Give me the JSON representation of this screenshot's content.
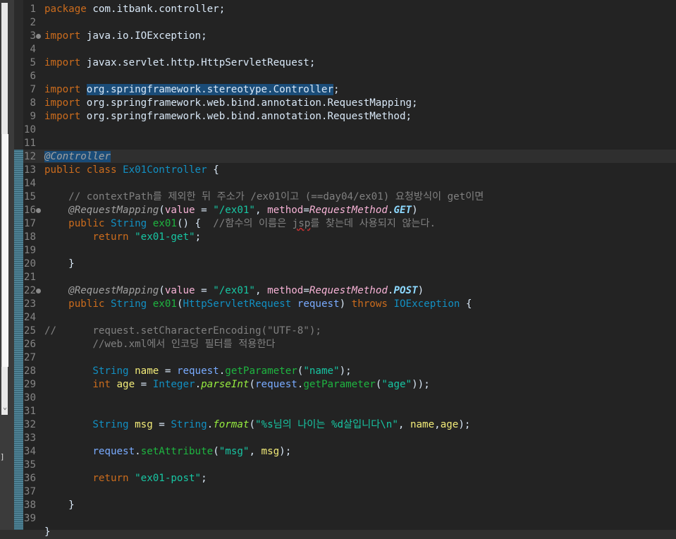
{
  "editor": {
    "lines": [
      {
        "n": "1",
        "fold": false,
        "tokens": [
          {
            "t": "package",
            "c": "kw"
          },
          {
            "t": " com.itbank.controller;",
            "c": "plain"
          }
        ]
      },
      {
        "n": "2",
        "fold": false,
        "tokens": []
      },
      {
        "n": "3",
        "fold": true,
        "tokens": [
          {
            "t": "import",
            "c": "kw"
          },
          {
            "t": " java.io.IOException;",
            "c": "plain"
          }
        ]
      },
      {
        "n": "4",
        "fold": false,
        "tokens": []
      },
      {
        "n": "5",
        "fold": false,
        "tokens": [
          {
            "t": "import",
            "c": "kw"
          },
          {
            "t": " javax.servlet.http.HttpServletRequest;",
            "c": "plain"
          }
        ]
      },
      {
        "n": "6",
        "fold": false,
        "tokens": []
      },
      {
        "n": "7",
        "fold": false,
        "tokens": [
          {
            "t": "import",
            "c": "kw"
          },
          {
            "t": " ",
            "c": "plain"
          },
          {
            "t": "org.springframework.stereotype.Controller",
            "c": "plain",
            "hl": true
          },
          {
            "t": ";",
            "c": "plain"
          }
        ]
      },
      {
        "n": "8",
        "fold": false,
        "tokens": [
          {
            "t": "import",
            "c": "kw"
          },
          {
            "t": " org.springframework.web.bind.annotation.RequestMapping;",
            "c": "plain"
          }
        ]
      },
      {
        "n": "9",
        "fold": false,
        "tokens": [
          {
            "t": "import",
            "c": "kw"
          },
          {
            "t": " org.springframework.web.bind.annotation.RequestMethod;",
            "c": "plain"
          }
        ]
      },
      {
        "n": "10",
        "fold": false,
        "tokens": []
      },
      {
        "n": "11",
        "fold": false,
        "tokens": []
      },
      {
        "n": "12",
        "fold": false,
        "tokens": [
          {
            "t": "@",
            "c": "ann",
            "hl": true
          },
          {
            "t": "Controller",
            "c": "ann",
            "hl": true
          }
        ]
      },
      {
        "n": "13",
        "fold": false,
        "tokens": [
          {
            "t": "public",
            "c": "kw"
          },
          {
            "t": " ",
            "c": "plain"
          },
          {
            "t": "class",
            "c": "kw"
          },
          {
            "t": " ",
            "c": "plain"
          },
          {
            "t": "Ex01Controller",
            "c": "cls"
          },
          {
            "t": " {",
            "c": "plain"
          }
        ]
      },
      {
        "n": "14",
        "fold": false,
        "tokens": []
      },
      {
        "n": "15",
        "fold": false,
        "tokens": [
          {
            "t": "    // contextPath를 제외한 뒤 주소가 /ex01이고 (==day04/ex01) 요청방식이 get이면",
            "c": "cm"
          }
        ]
      },
      {
        "n": "16",
        "fold": true,
        "tokens": [
          {
            "t": "    ",
            "c": "plain"
          },
          {
            "t": "@RequestMapping",
            "c": "ann"
          },
          {
            "t": "(",
            "c": "plain"
          },
          {
            "t": "value",
            "c": "attr"
          },
          {
            "t": " = ",
            "c": "plain"
          },
          {
            "t": "\"/ex01\"",
            "c": "str"
          },
          {
            "t": ", ",
            "c": "plain"
          },
          {
            "t": "method",
            "c": "attr"
          },
          {
            "t": "=",
            "c": "plain"
          },
          {
            "t": "RequestMethod",
            "c": "enumcls"
          },
          {
            "t": ".",
            "c": "plain"
          },
          {
            "t": "GET",
            "c": "enumb"
          },
          {
            "t": ")",
            "c": "plain"
          }
        ]
      },
      {
        "n": "17",
        "fold": false,
        "tokens": [
          {
            "t": "    ",
            "c": "plain"
          },
          {
            "t": "public",
            "c": "kw"
          },
          {
            "t": " ",
            "c": "plain"
          },
          {
            "t": "String",
            "c": "type"
          },
          {
            "t": " ",
            "c": "plain"
          },
          {
            "t": "ex01",
            "c": "method"
          },
          {
            "t": "() {  ",
            "c": "plain"
          },
          {
            "t": "//함수의 이름은 ",
            "c": "cm"
          },
          {
            "t": "jsp",
            "c": "cm",
            "squig": true
          },
          {
            "t": "를 찾는데 사용되지 않는다.",
            "c": "cm"
          }
        ]
      },
      {
        "n": "18",
        "fold": false,
        "tokens": [
          {
            "t": "        ",
            "c": "plain"
          },
          {
            "t": "return",
            "c": "kw"
          },
          {
            "t": " ",
            "c": "plain"
          },
          {
            "t": "\"ex01-get\"",
            "c": "str"
          },
          {
            "t": ";",
            "c": "plain"
          }
        ]
      },
      {
        "n": "19",
        "fold": false,
        "tokens": []
      },
      {
        "n": "20",
        "fold": false,
        "tokens": [
          {
            "t": "    }",
            "c": "plain"
          }
        ]
      },
      {
        "n": "21",
        "fold": false,
        "tokens": []
      },
      {
        "n": "22",
        "fold": true,
        "tokens": [
          {
            "t": "    ",
            "c": "plain"
          },
          {
            "t": "@RequestMapping",
            "c": "ann"
          },
          {
            "t": "(",
            "c": "plain"
          },
          {
            "t": "value",
            "c": "attr"
          },
          {
            "t": " = ",
            "c": "plain"
          },
          {
            "t": "\"/ex01\"",
            "c": "str"
          },
          {
            "t": ", ",
            "c": "plain"
          },
          {
            "t": "method",
            "c": "attr"
          },
          {
            "t": "=",
            "c": "plain"
          },
          {
            "t": "RequestMethod",
            "c": "enumcls"
          },
          {
            "t": ".",
            "c": "plain"
          },
          {
            "t": "POST",
            "c": "enumb"
          },
          {
            "t": ")",
            "c": "plain"
          }
        ]
      },
      {
        "n": "23",
        "fold": false,
        "tokens": [
          {
            "t": "    ",
            "c": "plain"
          },
          {
            "t": "public",
            "c": "kw"
          },
          {
            "t": " ",
            "c": "plain"
          },
          {
            "t": "String",
            "c": "type"
          },
          {
            "t": " ",
            "c": "plain"
          },
          {
            "t": "ex01",
            "c": "method"
          },
          {
            "t": "(",
            "c": "plain"
          },
          {
            "t": "HttpServletRequest",
            "c": "type"
          },
          {
            "t": " ",
            "c": "plain"
          },
          {
            "t": "request",
            "c": "param"
          },
          {
            "t": ") ",
            "c": "plain"
          },
          {
            "t": "throws",
            "c": "kw"
          },
          {
            "t": " ",
            "c": "plain"
          },
          {
            "t": "IOException",
            "c": "type"
          },
          {
            "t": " {",
            "c": "plain"
          }
        ]
      },
      {
        "n": "24",
        "fold": false,
        "tokens": []
      },
      {
        "n": "25",
        "fold": false,
        "tokens": [
          {
            "t": "//      request.setCharacterEncoding(\"UTF-8\");",
            "c": "cm"
          }
        ]
      },
      {
        "n": "26",
        "fold": false,
        "tokens": [
          {
            "t": "        //web.xml에서 인코딩 필터를 적용한다",
            "c": "cm"
          }
        ]
      },
      {
        "n": "27",
        "fold": false,
        "tokens": []
      },
      {
        "n": "28",
        "fold": false,
        "tokens": [
          {
            "t": "        ",
            "c": "plain"
          },
          {
            "t": "String",
            "c": "type"
          },
          {
            "t": " ",
            "c": "plain"
          },
          {
            "t": "name",
            "c": "var"
          },
          {
            "t": " = ",
            "c": "plain"
          },
          {
            "t": "request",
            "c": "param"
          },
          {
            "t": ".",
            "c": "plain"
          },
          {
            "t": "getParameter",
            "c": "method"
          },
          {
            "t": "(",
            "c": "plain"
          },
          {
            "t": "\"name\"",
            "c": "str"
          },
          {
            "t": ");",
            "c": "plain"
          }
        ]
      },
      {
        "n": "29",
        "fold": false,
        "tokens": [
          {
            "t": "        ",
            "c": "plain"
          },
          {
            "t": "int",
            "c": "kw"
          },
          {
            "t": " ",
            "c": "plain"
          },
          {
            "t": "age",
            "c": "var"
          },
          {
            "t": " = ",
            "c": "plain"
          },
          {
            "t": "Integer",
            "c": "type"
          },
          {
            "t": ".",
            "c": "plain"
          },
          {
            "t": "parseInt",
            "c": "smethod"
          },
          {
            "t": "(",
            "c": "plain"
          },
          {
            "t": "request",
            "c": "param"
          },
          {
            "t": ".",
            "c": "plain"
          },
          {
            "t": "getParameter",
            "c": "method"
          },
          {
            "t": "(",
            "c": "plain"
          },
          {
            "t": "\"age\"",
            "c": "str"
          },
          {
            "t": "));",
            "c": "plain"
          }
        ]
      },
      {
        "n": "30",
        "fold": false,
        "tokens": []
      },
      {
        "n": "31",
        "fold": false,
        "tokens": []
      },
      {
        "n": "32",
        "fold": false,
        "tokens": [
          {
            "t": "        ",
            "c": "plain"
          },
          {
            "t": "String",
            "c": "type"
          },
          {
            "t": " ",
            "c": "plain"
          },
          {
            "t": "msg",
            "c": "var"
          },
          {
            "t": " = ",
            "c": "plain"
          },
          {
            "t": "String",
            "c": "type"
          },
          {
            "t": ".",
            "c": "plain"
          },
          {
            "t": "format",
            "c": "smethod"
          },
          {
            "t": "(",
            "c": "plain"
          },
          {
            "t": "\"%s님의 나이는 %d살입니다\\n\"",
            "c": "str"
          },
          {
            "t": ", ",
            "c": "plain"
          },
          {
            "t": "name",
            "c": "var"
          },
          {
            "t": ",",
            "c": "plain"
          },
          {
            "t": "age",
            "c": "var"
          },
          {
            "t": ");",
            "c": "plain"
          }
        ]
      },
      {
        "n": "33",
        "fold": false,
        "tokens": []
      },
      {
        "n": "34",
        "fold": false,
        "tokens": [
          {
            "t": "        ",
            "c": "plain"
          },
          {
            "t": "request",
            "c": "param"
          },
          {
            "t": ".",
            "c": "plain"
          },
          {
            "t": "setAttribute",
            "c": "method"
          },
          {
            "t": "(",
            "c": "plain"
          },
          {
            "t": "\"msg\"",
            "c": "str"
          },
          {
            "t": ", ",
            "c": "plain"
          },
          {
            "t": "msg",
            "c": "var"
          },
          {
            "t": ");",
            "c": "plain"
          }
        ]
      },
      {
        "n": "35",
        "fold": false,
        "tokens": []
      },
      {
        "n": "36",
        "fold": false,
        "tokens": [
          {
            "t": "        ",
            "c": "plain"
          },
          {
            "t": "return",
            "c": "kw"
          },
          {
            "t": " ",
            "c": "plain"
          },
          {
            "t": "\"ex01-post\"",
            "c": "str"
          },
          {
            "t": ";",
            "c": "plain"
          }
        ]
      },
      {
        "n": "37",
        "fold": false,
        "tokens": []
      },
      {
        "n": "38",
        "fold": false,
        "tokens": [
          {
            "t": "    }",
            "c": "plain"
          }
        ]
      },
      {
        "n": "39",
        "fold": false,
        "tokens": []
      },
      {
        "n": "",
        "fold": false,
        "tokens": [
          {
            "t": "}",
            "c": "plain"
          }
        ]
      }
    ]
  },
  "left_strip": {
    "scroll_arrow_icon": "chevron-down-icon",
    "bracket_glyph": "]"
  }
}
